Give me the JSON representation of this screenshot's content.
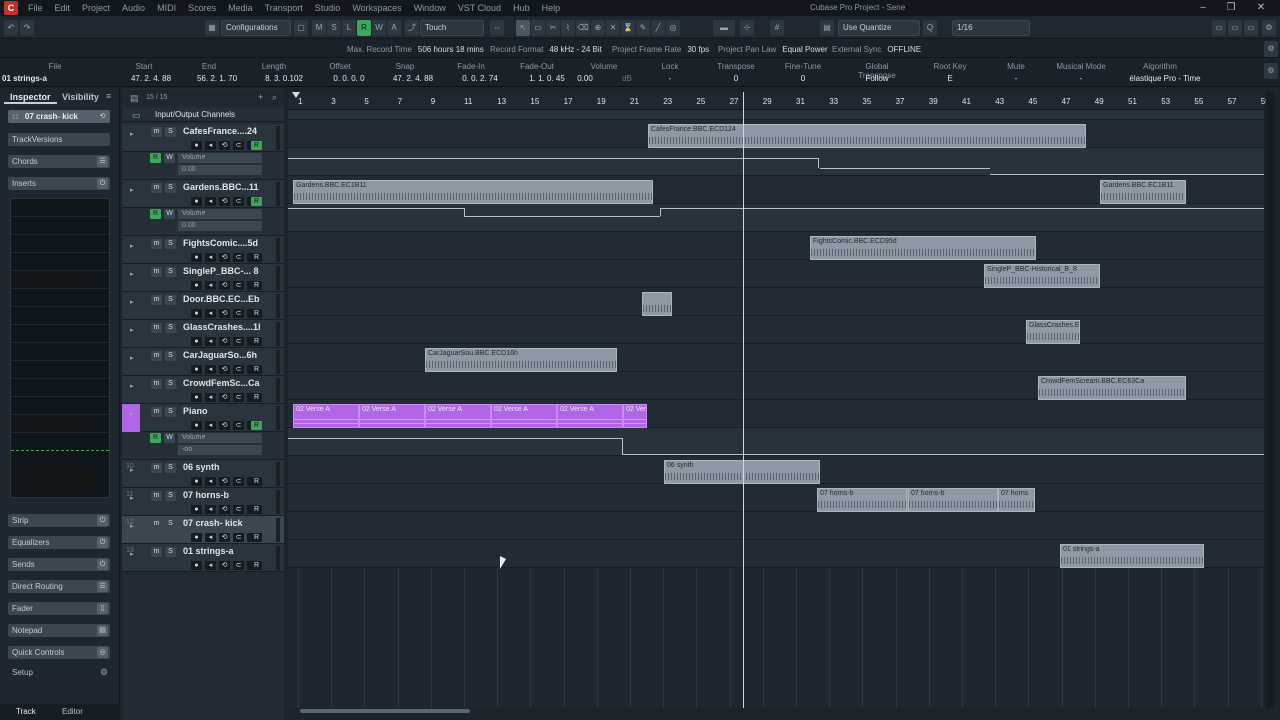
{
  "menu": {
    "items": [
      "File",
      "Edit",
      "Project",
      "Audio",
      "MIDI",
      "Scores",
      "Media",
      "Transport",
      "Studio",
      "Workspaces",
      "Window",
      "VST Cloud",
      "Hub",
      "Help"
    ],
    "title": "Cubase Pro Project - Sene"
  },
  "toolbar": {
    "configurations": "Configurations",
    "mode_buttons": [
      "M",
      "S",
      "L",
      "R",
      "W",
      "A"
    ],
    "automation_mode": "Touch",
    "quantize_label": "Use Quantize",
    "quantize_value": "1/16"
  },
  "statusline": {
    "max_record_label": "Max. Record Time",
    "max_record_value": "506 hours 18 mins",
    "record_format_label": "Record Format",
    "record_format_value": "48 kHz - 24 Bit",
    "frame_rate_label": "Project Frame Rate",
    "frame_rate_value": "30 fps",
    "pan_law_label": "Project Pan Law",
    "pan_law_value": "Equal Power",
    "ext_sync_label": "External Sync",
    "ext_sync_value": "OFFLINE"
  },
  "infoline": {
    "labels": [
      "File",
      "Start",
      "End",
      "Length",
      "Offset",
      "Snap",
      "Fade-In",
      "Fade-Out",
      "Volume",
      "Lock",
      "Transpose",
      "Fine-Tune",
      "Global Transpose",
      "Root Key",
      "Mute",
      "Musical Mode",
      "Algorithm"
    ],
    "values": [
      "01 strings-a",
      "47. 2. 4. 88",
      "56. 2. 1. 70",
      "8. 3. 0.102",
      "0. 0. 0. 0",
      "47. 2. 4. 88",
      "0. 0. 2. 74",
      "1. 1. 0. 45",
      "0.00",
      "-",
      "0",
      "0",
      "Follow",
      "E",
      "-",
      "-",
      "élastique Pro - Time"
    ],
    "volume_unit": "dB"
  },
  "inspector": {
    "tab_inspector": "Inspector",
    "tab_visibility": "Visibility",
    "track_name": "07 crash- kick",
    "track_num": "12",
    "sections_top": [
      "TrackVersions",
      "Chords",
      "Inserts"
    ],
    "sections_bottom": [
      "Strip",
      "Equalizers",
      "Sends",
      "Direct Routing",
      "Fader",
      "Notepad",
      "Quick Controls"
    ],
    "setup": "Setup",
    "bottom_tabs": [
      "Track",
      "Editor"
    ]
  },
  "tracklist": {
    "counter": "15 / 15",
    "folder": "Input/Output Channels",
    "tracks": [
      {
        "num": "",
        "name": "CafesFrance....24",
        "sub": "Volume",
        "subval": "0.00"
      },
      {
        "num": "",
        "name": "Gardens.BBC...11",
        "sub": "Volume",
        "subval": "0.00"
      },
      {
        "num": "",
        "name": "FightsComic....5d"
      },
      {
        "num": "",
        "name": "SingleP_BBC-... 8"
      },
      {
        "num": "",
        "name": "Door.BBC.EC...Eb"
      },
      {
        "num": "",
        "name": "GlassCrashes....1l"
      },
      {
        "num": "",
        "name": "CarJaguarSo...6h"
      },
      {
        "num": "",
        "name": "CrowdFemSc...Ca"
      },
      {
        "num": "",
        "name": "Piano",
        "sub": "Volume",
        "subval": "-oo"
      },
      {
        "num": "10",
        "name": "06 synth"
      },
      {
        "num": "11",
        "name": "07 horns-b"
      },
      {
        "num": "12",
        "name": "07 crash- kick"
      },
      {
        "num": "13",
        "name": "01 strings-a"
      }
    ]
  },
  "ruler": {
    "bars": [
      "1",
      "3",
      "5",
      "7",
      "9",
      "11",
      "13",
      "15",
      "17",
      "19",
      "21",
      "23",
      "25",
      "27",
      "29",
      "31",
      "33",
      "35",
      "37",
      "39",
      "41",
      "43",
      "45",
      "47",
      "49",
      "51",
      "53",
      "55",
      "57",
      "59"
    ]
  },
  "events": {
    "cafes": "CafesFrance.BBC.ECD124",
    "gardens1": "Gardens.BBC.EC1B11",
    "gardens2": "Gardens.BBC.EC1B11",
    "fights": "FightsComic.BBC.ECD95d",
    "singlep": "SingleP_BBC-Historical_B_8",
    "glass": "GlassCrashes.E",
    "car": "CarJaguarSou.BBC.ECD16h",
    "crowd": "CrowdFemScream.BBC.EC63Ca",
    "piano": [
      "02 Verse A",
      "02 Verse A",
      "02 Verse A",
      "02 Verse A",
      "02 Verse A",
      "02 Ver"
    ],
    "synth": "06 synth",
    "horns": [
      "07 horns-b",
      "07 horns-b",
      "07 horns"
    ],
    "strings": "01 strings-a"
  },
  "colors": {
    "midi": "#b066e6",
    "record": "#3da75c",
    "background": "#1b232b"
  }
}
